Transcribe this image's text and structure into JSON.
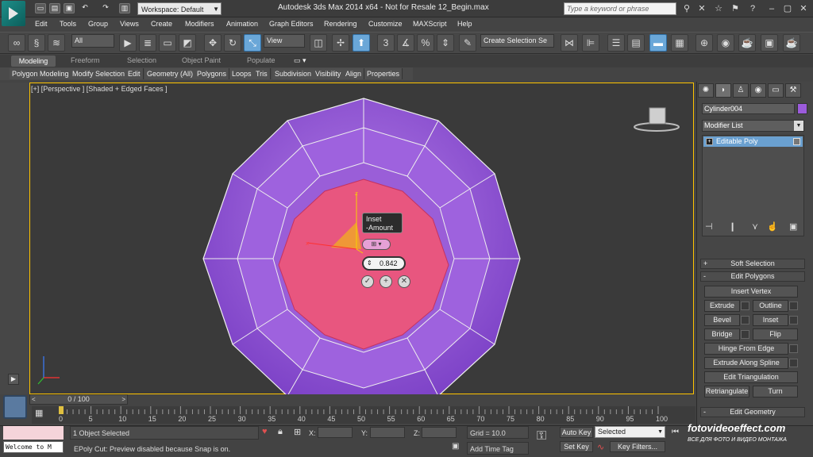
{
  "title_bar": {
    "title": "Autodesk 3ds Max  2014 x64   -  Not for Resale   12_Begin.max",
    "workspace": "Workspace: Default",
    "search_placeholder": "Type a keyword or phrase"
  },
  "menu": [
    "Edit",
    "Tools",
    "Group",
    "Views",
    "Create",
    "Modifiers",
    "Animation",
    "Graph Editors",
    "Rendering",
    "Customize",
    "MAXScript",
    "Help"
  ],
  "main_toolbar": {
    "selection_filter": "All",
    "reference_coord": "View",
    "named_selection": "Create Selection Se",
    "snap_label": "3"
  },
  "ribbon": {
    "tabs": [
      "Modeling",
      "Freeform",
      "Selection",
      "Object Paint",
      "Populate"
    ],
    "active_tab": "Modeling",
    "panels": [
      "Polygon Modeling",
      "Modify Selection",
      "Edit",
      "Geometry (All)",
      "Polygons",
      "Loops",
      "Tris",
      "Subdivision",
      "Visibility",
      "Align",
      "Properties"
    ]
  },
  "viewport": {
    "label": "[+] [Perspective ] [Shaded + Edged Faces ]",
    "caddy": {
      "title_line1": "Inset",
      "title_line2": "-Amount",
      "value": "0.842"
    }
  },
  "command_panel": {
    "object_name": "Cylinder004",
    "object_color": "#9b5bdb",
    "modifier_list": "Modifier List",
    "stack_item": "Editable Poly",
    "rollouts": {
      "soft_selection": "Soft Selection",
      "edit_polygons": "Edit Polygons",
      "edit_geometry": "Edit Geometry"
    },
    "buttons": {
      "insert_vertex": "Insert Vertex",
      "extrude": "Extrude",
      "outline": "Outline",
      "bevel": "Bevel",
      "inset": "Inset",
      "bridge": "Bridge",
      "flip": "Flip",
      "hinge": "Hinge From Edge",
      "extrude_spline": "Extrude Along Spline",
      "edit_tri": "Edit Triangulation",
      "retriangulate": "Retriangulate",
      "turn": "Turn"
    }
  },
  "timeline": {
    "slider": "0 / 100",
    "ticks": [
      "0",
      "5",
      "10",
      "15",
      "20",
      "25",
      "30",
      "35",
      "40",
      "45",
      "50",
      "55",
      "60",
      "65",
      "70",
      "75",
      "80",
      "85",
      "90",
      "95",
      "100"
    ]
  },
  "status": {
    "maxscript_output": "Welcome to M",
    "selection": "1 Object Selected",
    "prompt": "EPoly Cut: Preview disabled because Snap is on.",
    "x_label": "X:",
    "y_label": "Y:",
    "z_label": "Z:",
    "grid": "Grid = 10.0",
    "add_time_tag": "Add Time Tag",
    "auto_key": "Auto Key",
    "set_key": "Set Key",
    "selected_dd": "Selected",
    "key_filters": "Key Filters..."
  },
  "watermark": {
    "main": "fotovideoeffect.com",
    "sub": "ВСЕ ДЛЯ ФОТО И ВИДЕО МОНТАЖА"
  }
}
